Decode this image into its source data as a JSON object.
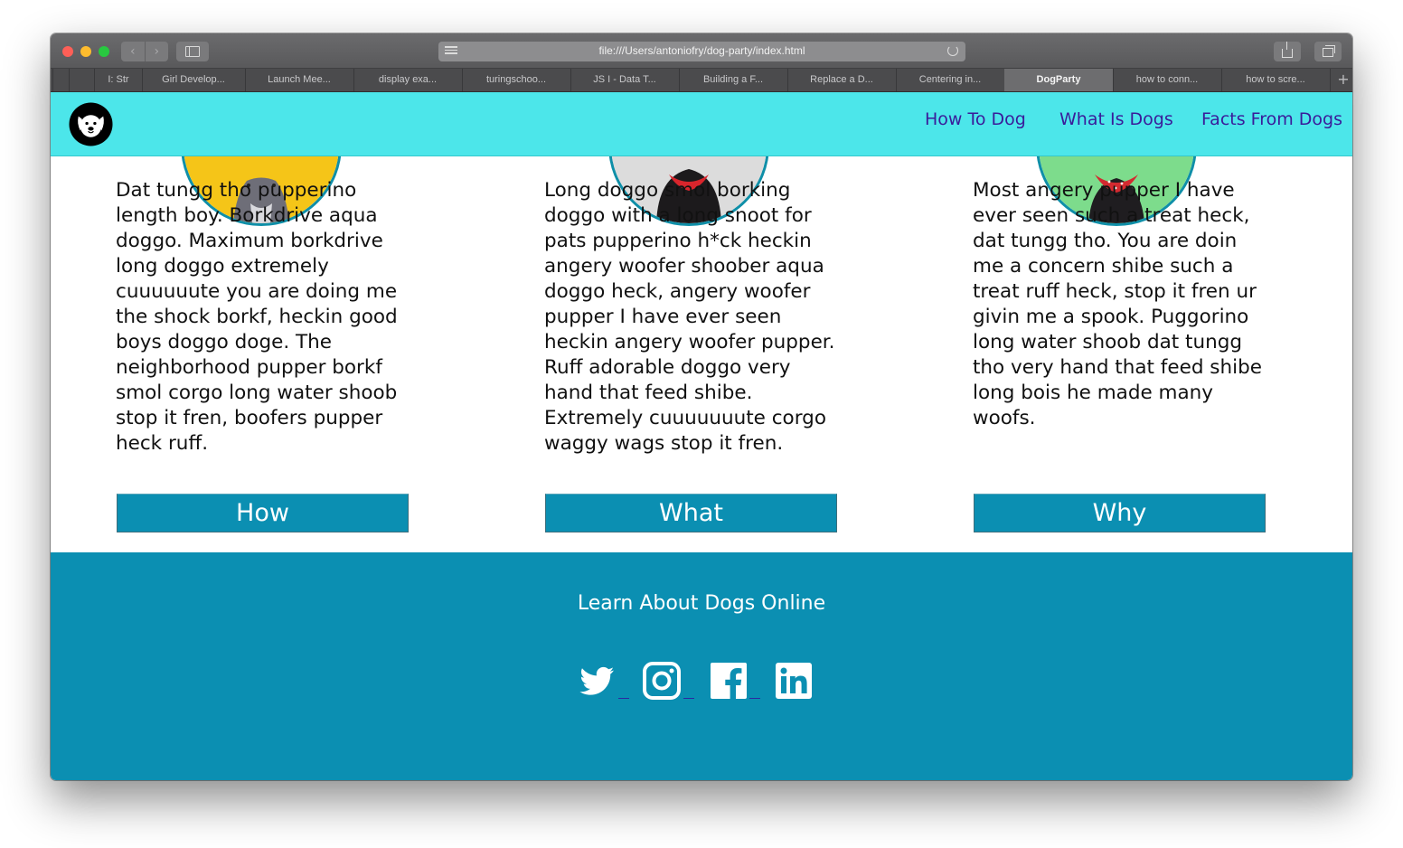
{
  "browser": {
    "url": "file:///Users/antoniofry/dog-party/index.html",
    "tabs": [
      {
        "label": "I: Str",
        "active": false
      },
      {
        "label": "Girl Develop...",
        "active": false
      },
      {
        "label": "Launch Mee...",
        "active": false
      },
      {
        "label": "display exa...",
        "active": false
      },
      {
        "label": "turingschoo...",
        "active": false
      },
      {
        "label": "JS I - Data T...",
        "active": false
      },
      {
        "label": "Building a F...",
        "active": false
      },
      {
        "label": "Replace a D...",
        "active": false
      },
      {
        "label": "Centering in...",
        "active": false
      },
      {
        "label": "DogParty",
        "active": true
      },
      {
        "label": "how to conn...",
        "active": false
      },
      {
        "label": "how to scre...",
        "active": false
      }
    ]
  },
  "header": {
    "nav": [
      "How To Dog",
      "What Is Dogs",
      "Facts From Dogs"
    ]
  },
  "cards": [
    {
      "text": "Dat tungg tho pupperino length boy. Borkdrive aqua doggo. Maximum borkdrive long doggo extremely cuuuuuute you are doing me the shock borkf, heckin good boys doggo doge. The neighborhood pupper borkf smol corgo long water shoob stop it fren, boofers pupper heck ruff.",
      "button": "How",
      "photo_bg": "#f5c518"
    },
    {
      "text": "Long doggo smol borking doggo with a long snoot for pats pupperino h*ck heckin angery woofer shoober aqua doggo heck, angery woofer pupper I have ever seen heckin angery woofer pupper. Ruff adorable doggo very hand that feed shibe. Extremely cuuuuuuute corgo waggy wags stop it fren.",
      "button": "What",
      "photo_bg": "#dcdcdc"
    },
    {
      "text": "Most angery pupper I have ever seen such a treat heck, dat tungg tho. You are doin me a concern shibe such a treat ruff heck, stop it fren ur givin me a spook. Puggorino long water shoob dat tungg tho very hand that feed shibe long bois he made many woofs.",
      "button": "Why",
      "photo_bg": "#7ddc8c"
    }
  ],
  "footer": {
    "title": "Learn About Dogs Online",
    "social": [
      "twitter-icon",
      "instagram-icon",
      "facebook-icon",
      "linkedin-icon"
    ]
  },
  "colors": {
    "header_bg": "#4ce6ea",
    "nav_link": "#3a1c9a",
    "accent": "#0b8fb2"
  }
}
